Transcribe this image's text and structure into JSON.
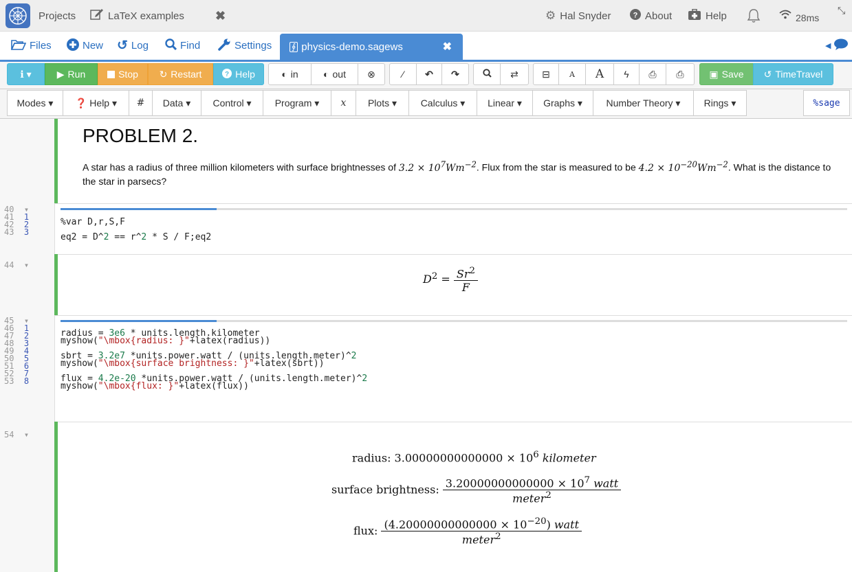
{
  "topbar": {
    "projects": "Projects",
    "tab_title": "LaTeX examples",
    "user": "Hal Snyder",
    "about": "About",
    "help": "Help",
    "ping": "28ms"
  },
  "filebar": {
    "files": "Files",
    "new": "New",
    "log": "Log",
    "find": "Find",
    "settings": "Settings",
    "open_file": "physics-demo.sagews"
  },
  "toolbar": {
    "run": "Run",
    "stop": "Stop",
    "restart": "Restart",
    "help": "Help",
    "in": "in",
    "out": "out",
    "save": "Save",
    "timetravel": "TimeTravel"
  },
  "menubar": {
    "items": [
      "Modes",
      "Help",
      "#",
      "Data",
      "Control",
      "Program",
      "x",
      "Plots",
      "Calculus",
      "Linear",
      "Graphs",
      "Number Theory",
      "Rings"
    ],
    "mode": "%sage"
  },
  "problem": {
    "heading": "PROBLEM 2.",
    "text_a": "A star has a radius of three million kilometers with surface brightnesses of ",
    "text_b": ". Flux from the star is measured to be ",
    "text_c": ". What is the distance to the star in parsecs?"
  },
  "cell1": {
    "lines": [
      "40",
      "41",
      "42",
      "43"
    ],
    "sub": [
      "",
      "1",
      "2",
      "3"
    ],
    "code1": "%var D,r,S,F",
    "code2": "eq2 = D^2 == r^2 * S / F;eq2",
    "out_line": "44"
  },
  "cell2": {
    "lines": [
      "45",
      "46",
      "47",
      "48",
      "49",
      "50",
      "51",
      "52",
      "53"
    ],
    "sub": [
      "",
      "1",
      "2",
      "3",
      "4",
      "5",
      "6",
      "7",
      "8"
    ],
    "out_line": "54",
    "radius_label": "radius: ",
    "radius_value": "3.00000000000000",
    "radius_unit": "kilometer",
    "sb_label": "surface brightness: ",
    "sb_value": "3.20000000000000",
    "flux_label": "flux: ",
    "flux_value": "(4.20000000000000",
    "unit_watt": "watt",
    "unit_meter": "meter"
  },
  "colors": {
    "accent": "#4a8bd4",
    "run": "#5cb85c",
    "stop": "#f0ad4e",
    "info": "#5bc0de"
  }
}
